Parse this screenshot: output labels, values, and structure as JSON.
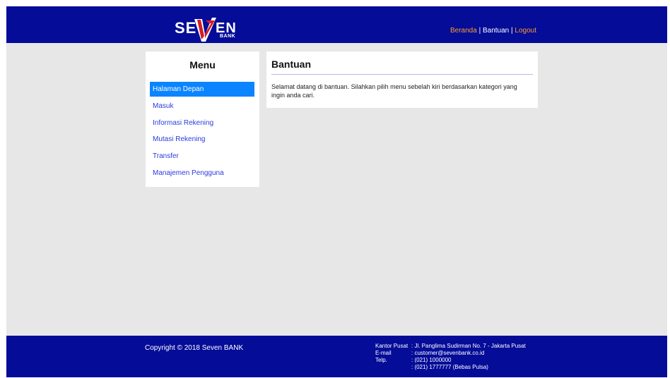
{
  "header": {
    "logo": {
      "text_left": "SE",
      "text_right": "EN",
      "sub": "BANK"
    },
    "nav": [
      {
        "label": "Beranda"
      },
      {
        "label": "Bantuan"
      },
      {
        "label": "Logout"
      }
    ],
    "separator": "|",
    "colors": {
      "background": "#040c98",
      "nav_link": "#ff9a2e",
      "nav_current": "#ffffff"
    }
  },
  "menu": {
    "title": "Menu",
    "items": [
      {
        "label": "Halaman Depan",
        "active": true
      },
      {
        "label": "Masuk"
      },
      {
        "label": "Informasi Rekening"
      },
      {
        "label": "Mutasi Rekening"
      },
      {
        "label": "Transfer"
      },
      {
        "label": "Manajemen Pengguna"
      }
    ],
    "colors": {
      "active_bg": "#0a84ff",
      "link": "#2a3bdc"
    }
  },
  "content": {
    "title": "Bantuan",
    "text": "Selamat datang di bantuan. Silahkan pilih menu sebelah kiri berdasarkan kategori yang ingin anda cari."
  },
  "footer": {
    "copyright": "Copyright © 2018 Seven BANK",
    "info": [
      {
        "label": "Kantor Pusat",
        "value": ": Jl. Panglima Sudirman No. 7 - Jakarta Pusat"
      },
      {
        "label": "E-mail",
        "value": ": customer@sevenbank.co.id"
      },
      {
        "label": "Telp.",
        "value": ": (021) 1000000"
      },
      {
        "label": "",
        "value": ": (021) 1777777 (Bebas Pulsa)"
      }
    ]
  }
}
